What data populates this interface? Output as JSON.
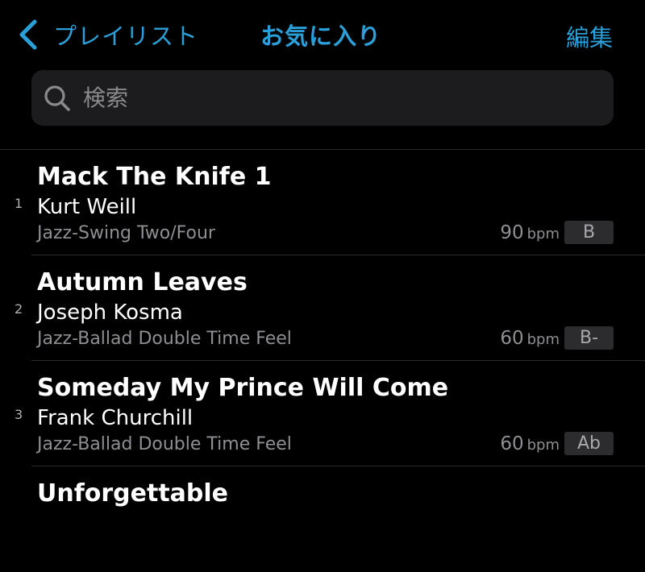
{
  "navbar": {
    "back_label": "プレイリスト",
    "title": "お気に入り",
    "edit_label": "編集",
    "accent_color": "#2a9fd8"
  },
  "search": {
    "placeholder": "検索",
    "value": ""
  },
  "songs": [
    {
      "index": "1",
      "title": "Mack The Knife 1",
      "composer": "Kurt Weill",
      "style": "Jazz-Swing Two/Four",
      "tempo": "90",
      "tempo_unit": "bpm",
      "key": "B"
    },
    {
      "index": "2",
      "title": "Autumn Leaves",
      "composer": "Joseph Kosma",
      "style": "Jazz-Ballad Double Time Feel",
      "tempo": "60",
      "tempo_unit": "bpm",
      "key": "B-"
    },
    {
      "index": "3",
      "title": "Someday My Prince Will Come",
      "composer": "Frank Churchill",
      "style": "Jazz-Ballad Double Time Feel",
      "tempo": "60",
      "tempo_unit": "bpm",
      "key": "Ab"
    },
    {
      "index": "",
      "title": "Unforgettable",
      "composer": "",
      "style": "",
      "tempo": "",
      "tempo_unit": "",
      "key": ""
    }
  ],
  "icons": {
    "back": "chevron-left-icon",
    "search": "search-icon"
  }
}
